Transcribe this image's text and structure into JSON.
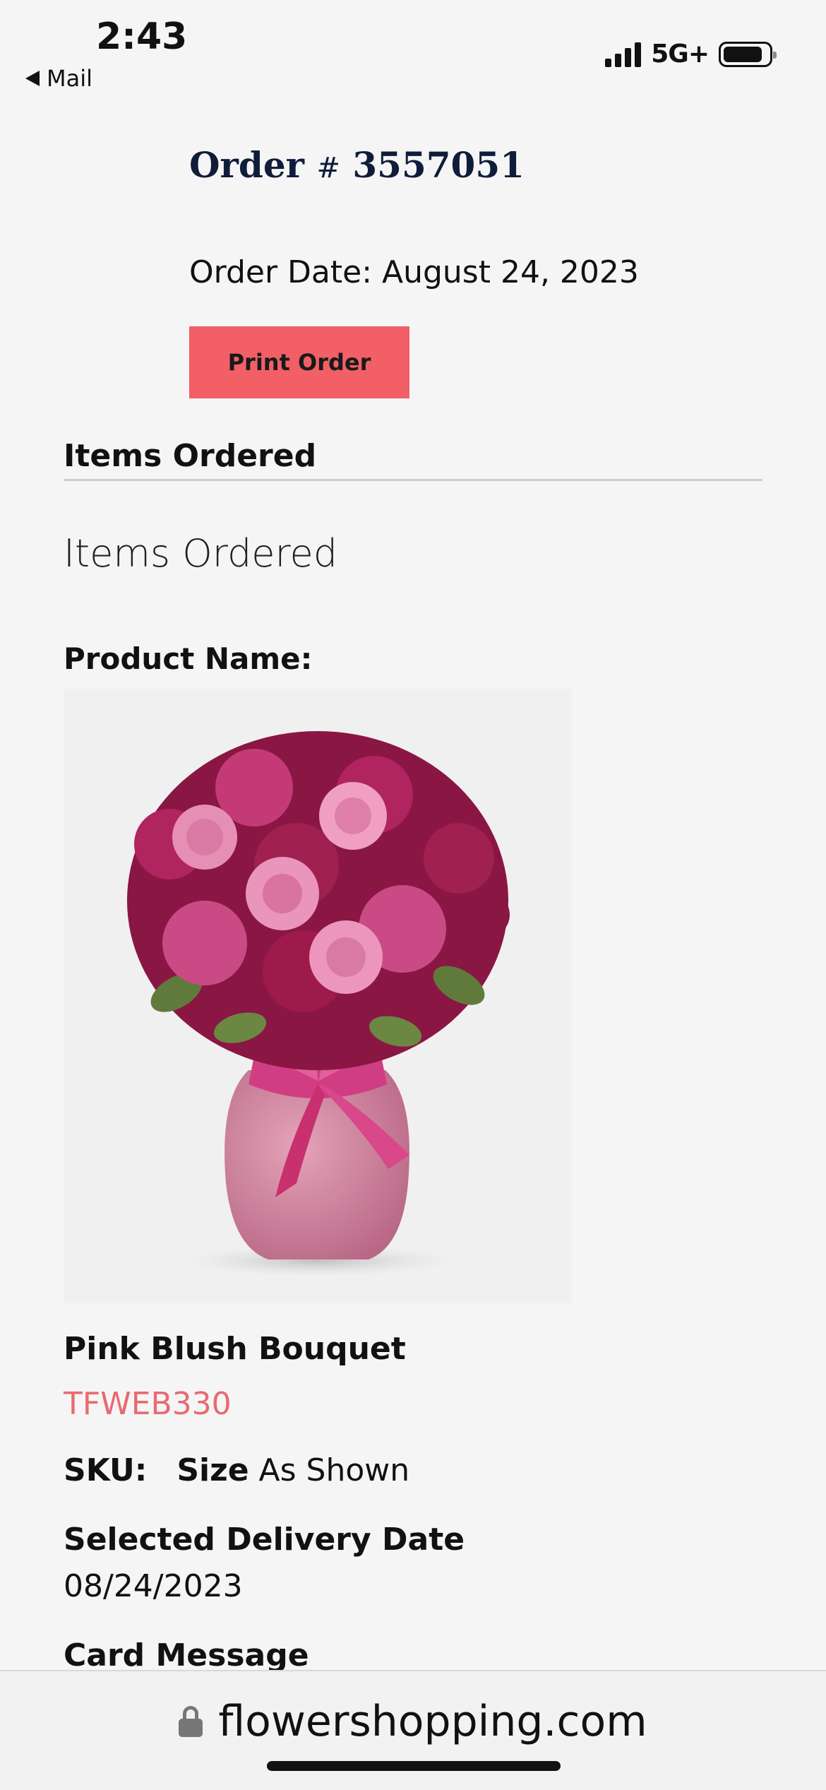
{
  "status_bar": {
    "time": "2:43",
    "back_app": "Mail",
    "network": "5G+"
  },
  "order": {
    "title_prefix": "Order",
    "hash": "#",
    "number": "3557051",
    "date": "Order Date: August 24, 2023",
    "print_label": "Print Order"
  },
  "items": {
    "section_heading": "Items Ordered",
    "section_subheading": "Items Ordered",
    "product_name_label": "Product Name:",
    "product_title": "Pink Blush Bouquet",
    "product_code": "TFWEB330",
    "sku_label": "SKU:",
    "size_label": "Size",
    "size_value": "As Shown",
    "delivery_label": "Selected Delivery Date",
    "delivery_date": "08/24/2023",
    "card_label": "Card Message"
  },
  "browser": {
    "url": "flowershopping.com"
  },
  "colors": {
    "accent": "#f25f66",
    "code_text": "#e86a70",
    "title_navy": "#0f1d3a"
  }
}
